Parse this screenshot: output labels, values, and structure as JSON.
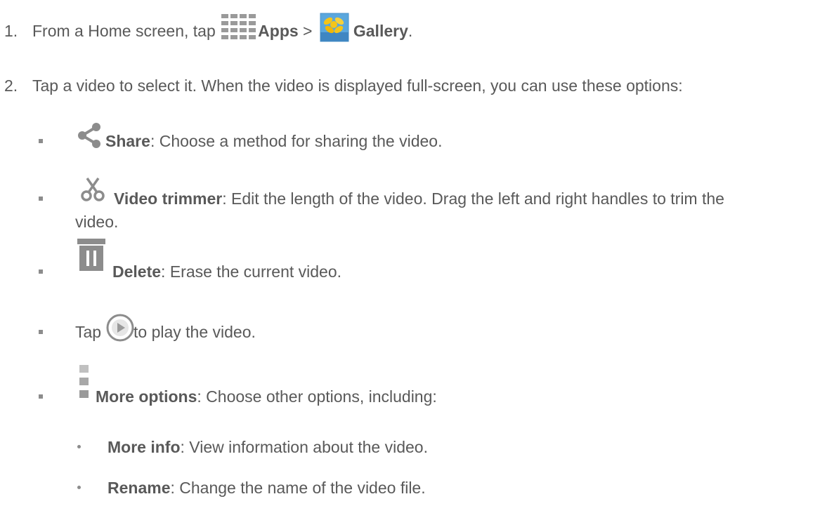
{
  "step1": {
    "number": "1.",
    "text_before": "From a Home screen, tap ",
    "apps_label": "Apps",
    "separator": " > ",
    "gallery_label": "Gallery",
    "end": ".",
    "icons": [
      "apps-grid-icon",
      "gallery-icon"
    ]
  },
  "step2": {
    "number": "2.",
    "text": "Tap a video to select it. When the video is displayed full-screen, you can use these options:"
  },
  "options": [
    {
      "icon": "share-icon",
      "label": "Share",
      "text": ": Choose a method for sharing the video."
    },
    {
      "icon": "scissors-icon",
      "label": "Video trimmer",
      "text": ": Edit the length of the video. Drag the left and right handles to trim the",
      "text_line2": "video."
    },
    {
      "icon": "trash-icon",
      "label": "Delete",
      "text": ": Erase the current video."
    },
    {
      "icon": "play-circle-icon",
      "prefix": "Tap ",
      "text": " to play the video."
    },
    {
      "icon": "more-options-icon",
      "label": "More options",
      "text": ": Choose other options, including:"
    }
  ],
  "sub_options": [
    {
      "label": "More info",
      "text": ": View information about the video."
    },
    {
      "label": "Rename",
      "text": ": Change the name of the video file."
    }
  ],
  "colors": {
    "text": "#595959",
    "icon_gray": "#8c8c8c",
    "gallery_blue": "#4a90c8",
    "gallery_yellow": "#f5c518"
  }
}
